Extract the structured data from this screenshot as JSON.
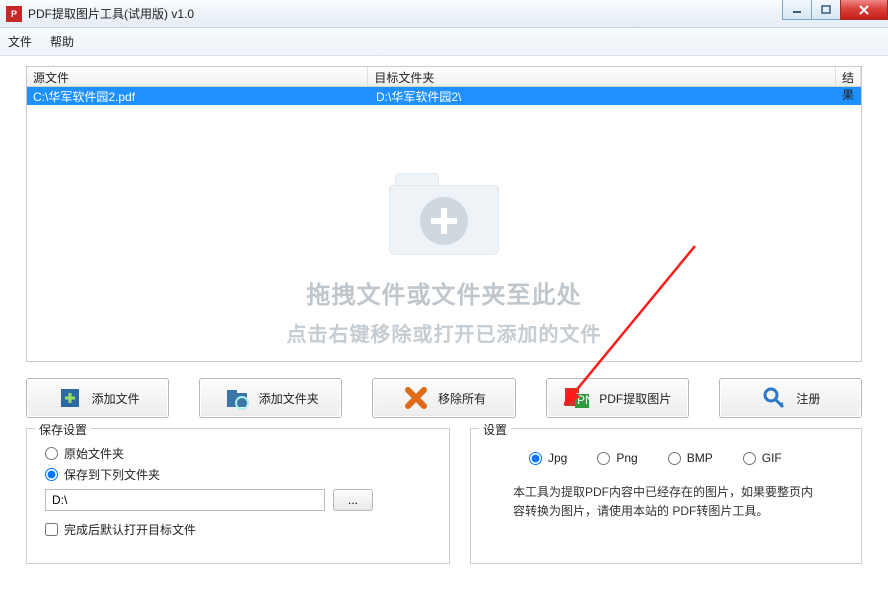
{
  "window": {
    "title": "PDF提取图片工具(试用版) v1.0"
  },
  "menu": {
    "file": "文件",
    "help": "帮助"
  },
  "table": {
    "headers": {
      "source": "源文件",
      "target": "目标文件夹",
      "result": "结果"
    },
    "rows": [
      {
        "source": "C:\\华军软件园2.pdf",
        "target": "D:\\华军软件园2\\",
        "result": ""
      }
    ]
  },
  "dropzone": {
    "line1": "拖拽文件或文件夹至此处",
    "line2": "点击右键移除或打开已添加的文件"
  },
  "toolbar": {
    "addFile": "添加文件",
    "addFolder": "添加文件夹",
    "removeAll": "移除所有",
    "extract": "PDF提取图片",
    "register": "注册"
  },
  "saveGroup": {
    "legend": "保存设置",
    "originalFolder": "原始文件夹",
    "customFolder": "保存到下列文件夹",
    "path": "D:\\",
    "browse": "...",
    "openAfter": "完成后默认打开目标文件",
    "selected": "custom"
  },
  "settingsGroup": {
    "legend": "设置",
    "formats": {
      "jpg": "Jpg",
      "png": "Png",
      "bmp": "BMP",
      "gif": "GIF"
    },
    "selected": "jpg",
    "description": "本工具为提取PDF内容中已经存在的图片，如果要整页内容转换为图片，请使用本站的 PDF转图片工具。"
  }
}
